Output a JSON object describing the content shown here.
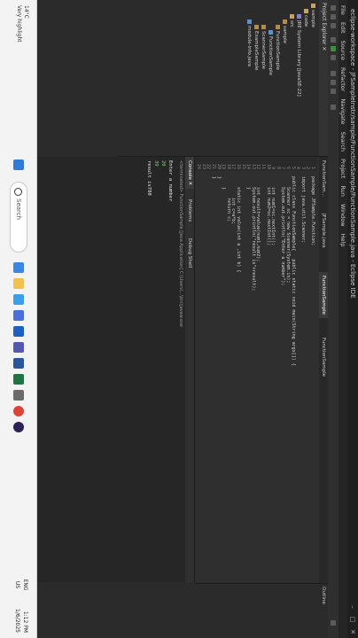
{
  "window": {
    "title": "eclipse-workspace - JFSampleInstr/sample/FunctionSample/FunctionSample.java - Eclipse IDE",
    "controls": [
      "–",
      "□",
      "✕"
    ]
  },
  "menu": [
    "File",
    "Edit",
    "Source",
    "Refactor",
    "Navigate",
    "Search",
    "Project",
    "Run",
    "Window",
    "Help"
  ],
  "explorer": {
    "title": "Project Explorer ✕",
    "items": [
      "sample",
      "code",
      "JRE System Library [JavaSE-22]",
      "src",
      "sample",
      "FunctionSample",
      "FunctionSample",
      "ScannerSample",
      "ExampleSample",
      "module-info.java"
    ]
  },
  "editor": {
    "tabs": [
      "FunctionSam...",
      "JFSample.java",
      "FunctionSample",
      "FunctionSample"
    ],
    "lines": [
      {
        "n": "1",
        "text": "package JFSample.Function;"
      },
      {
        "n": "2",
        "text": ""
      },
      {
        "n": "3",
        "text": "import java.util.Scanner;"
      },
      {
        "n": "4",
        "text": ""
      },
      {
        "n": "5",
        "text": "public class FunctionSample{   public static void main(String args[]) {"
      },
      {
        "n": "6",
        "text": "    Scanner sc = new Scanner(System.in);"
      },
      {
        "n": "7",
        "text": "    System.out.println(\"Enter a number\");"
      },
      {
        "n": "8",
        "text": ""
      },
      {
        "n": "9",
        "text": "    int num1=sc.nextInt();"
      },
      {
        "n": "10",
        "text": "    int num2=sc.nextInt();"
      },
      {
        "n": "11",
        "text": ""
      },
      {
        "n": "12",
        "text": "    int result=value(num1,num2);"
      },
      {
        "n": "13",
        "text": "    System.out.println(\"result is\"+result);"
      },
      {
        "n": "14",
        "text": "    }"
      },
      {
        "n": "15",
        "text": ""
      },
      {
        "n": "16",
        "text": "    static int value(int a ,int b) {"
      },
      {
        "n": "17",
        "text": "        int c=a*b;"
      },
      {
        "n": "18",
        "text": "        return c;"
      },
      {
        "n": "19",
        "text": "    }"
      },
      {
        "n": "20",
        "text": "}"
      },
      {
        "n": "21",
        "text": "}"
      },
      {
        "n": "22",
        "text": ""
      },
      {
        "n": "23",
        "text": ""
      },
      {
        "n": "24",
        "text": ""
      }
    ]
  },
  "outline": {
    "title": "Outline"
  },
  "console": {
    "tabs": [
      "Console ✕",
      "Problems",
      "Debug Shell"
    ],
    "path": "<terminated> FunctionSample [Java Application] C:\\Users\\...\\bin\\javaw.exe",
    "lines": [
      {
        "text": "Enter a number",
        "input": false
      },
      {
        "text": "20",
        "input": true
      },
      {
        "text": "39",
        "input": true
      },
      {
        "text": "result is780",
        "input": false
      }
    ]
  },
  "taskbar": {
    "weather_temp": "14°C",
    "weather_desc": "Very highlight",
    "search_placeholder": "Search",
    "lang": "ENG\nUS",
    "time": "1:12 PM",
    "date": "1/6/2025",
    "icons": [
      "start-icon",
      "search-icon",
      "widgets-icon",
      "file-explorer-icon",
      "edge-icon",
      "store-icon",
      "mail-icon",
      "teams-icon",
      "word-icon",
      "excel-icon",
      "settings-icon",
      "chrome-icon",
      "eclipse-icon"
    ]
  }
}
